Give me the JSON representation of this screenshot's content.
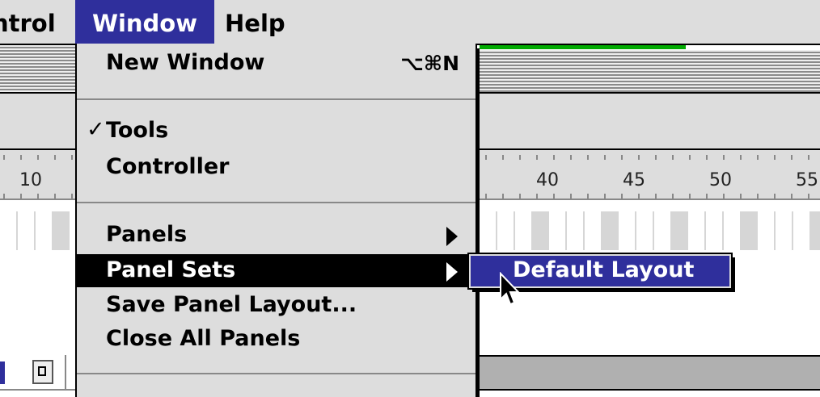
{
  "menubar": {
    "items": [
      {
        "label": "ntrol"
      },
      {
        "label": "Window"
      },
      {
        "label": "Help"
      }
    ]
  },
  "window_menu": {
    "new_window": {
      "label": "New Window",
      "shortcut": "⌥⌘N"
    },
    "tools": {
      "label": "Tools",
      "checked": true,
      "check": "✓"
    },
    "controller": {
      "label": "Controller"
    },
    "panels": {
      "label": "Panels",
      "submenu": true
    },
    "panel_sets": {
      "label": "Panel Sets",
      "submenu": true,
      "highlighted": true
    },
    "save_panel_layout": {
      "label": "Save Panel Layout..."
    },
    "close_all_panels": {
      "label": "Close All Panels"
    }
  },
  "submenu": {
    "items": [
      {
        "label": "Default Layout",
        "highlighted": true
      }
    ]
  },
  "timeline": {
    "ruler_left": [
      "10"
    ],
    "ruler_right": [
      "40",
      "45",
      "50",
      "55"
    ]
  },
  "colors": {
    "highlight": "#2f2f9c",
    "menu_background": "#dddddd",
    "playhead_green": "#00aa00"
  },
  "icons": {
    "cursor": "arrow-pointer-icon",
    "submenu_arrow": "triangle-right-icon",
    "checkmark": "checkmark-icon"
  }
}
